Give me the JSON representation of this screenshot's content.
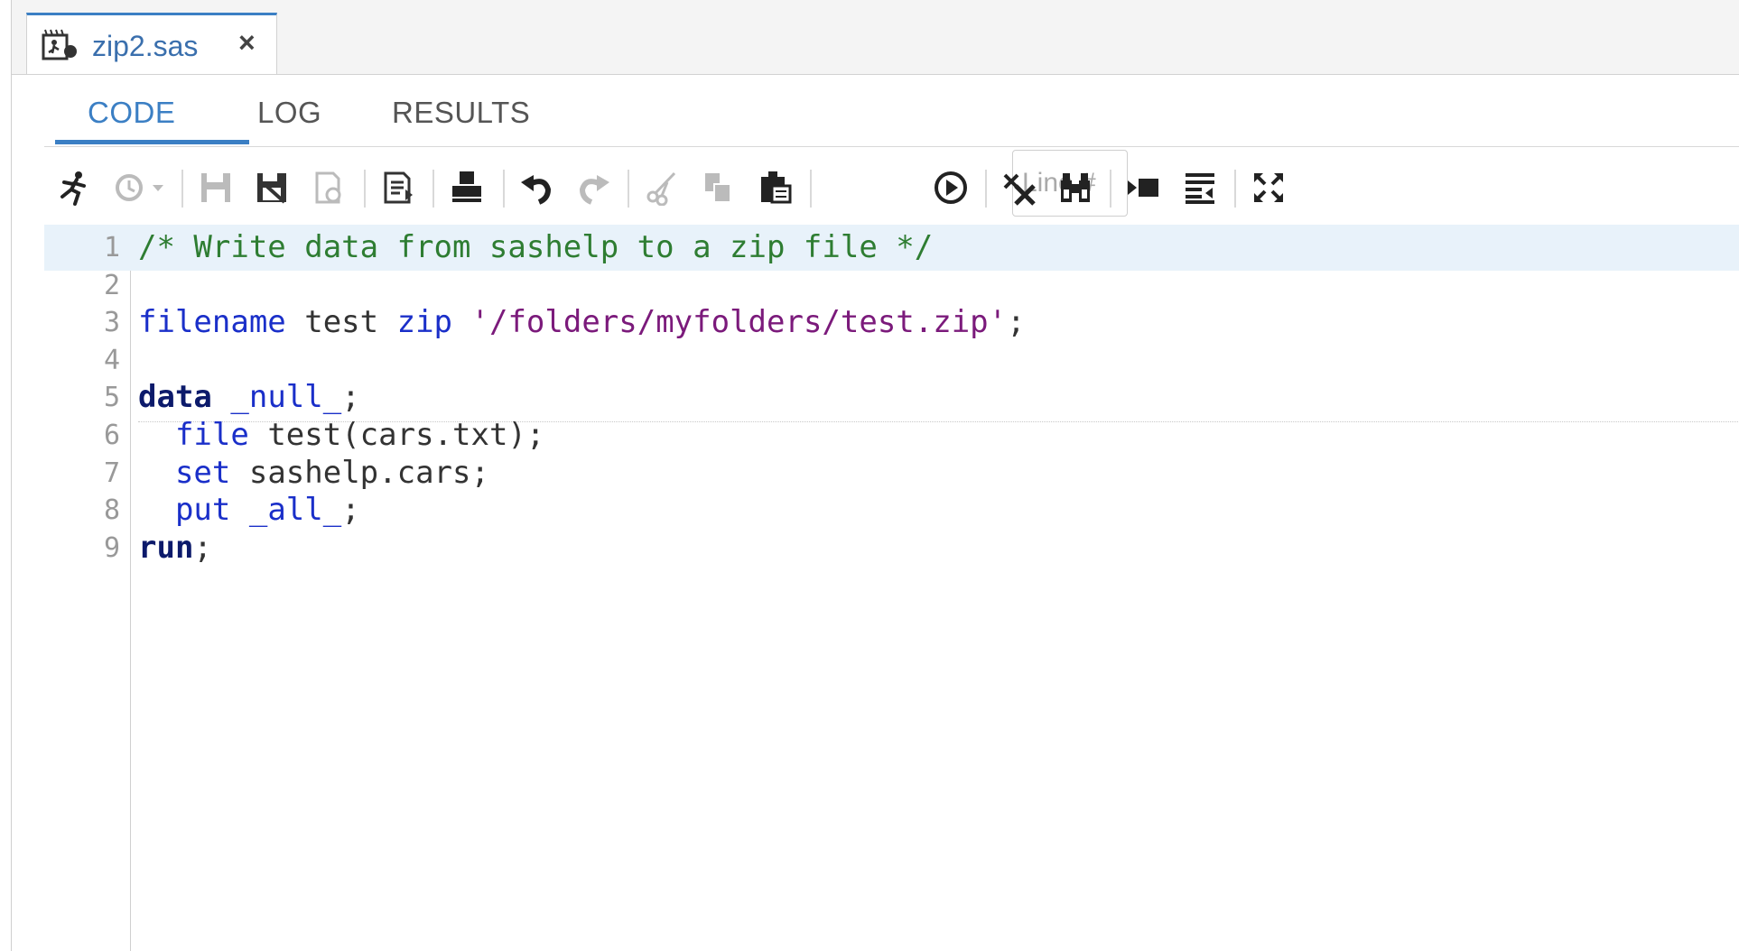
{
  "document_tab": {
    "icon": "sas-program-file-icon",
    "name": "zip2.sas",
    "close_glyph": "×"
  },
  "view_tabs": [
    {
      "label": "CODE",
      "active": true
    },
    {
      "label": "LOG",
      "active": false
    },
    {
      "label": "RESULTS",
      "active": false
    }
  ],
  "toolbar": {
    "line_input_placeholder": "Line #",
    "icons": [
      "run-icon",
      "history-icon",
      "save-icon",
      "save-as-icon",
      "open-icon",
      "export-code-icon",
      "print-icon",
      "undo-icon",
      "redo-icon",
      "cut-icon",
      "copy-icon",
      "paste-icon",
      "go-to-line-icon",
      "clear-icon",
      "find-replace-icon",
      "format-code-icon",
      "snippets-icon",
      "maximize-icon"
    ]
  },
  "colors": {
    "accent": "#3b7fc4",
    "comment": "#2e7d32",
    "keyword": "#1a2fc9",
    "string": "#7b1a7b",
    "step": "#0c1a6b"
  },
  "editor": {
    "current_line": 1,
    "lines": [
      {
        "num": "1",
        "tokens": [
          {
            "t": "/* Write data from sashelp to a zip file */",
            "c": "comment"
          }
        ]
      },
      {
        "num": "2",
        "tokens": []
      },
      {
        "num": "3",
        "tokens": [
          {
            "t": "filename",
            "c": "kw"
          },
          {
            "t": " test ",
            "c": "plain"
          },
          {
            "t": "zip",
            "c": "kw"
          },
          {
            "t": " ",
            "c": "plain"
          },
          {
            "t": "'/folders/myfolders/test.zip'",
            "c": "str"
          },
          {
            "t": ";",
            "c": "plain"
          }
        ]
      },
      {
        "num": "4",
        "tokens": []
      },
      {
        "num": "5",
        "tokens": [
          {
            "t": "data",
            "c": "step"
          },
          {
            "t": " ",
            "c": "plain"
          },
          {
            "t": "_null_",
            "c": "kw"
          },
          {
            "t": ";",
            "c": "plain"
          }
        ]
      },
      {
        "num": "6",
        "tokens": [
          {
            "t": "  ",
            "c": "plain"
          },
          {
            "t": "file",
            "c": "kw"
          },
          {
            "t": " test(cars.txt);",
            "c": "plain"
          }
        ]
      },
      {
        "num": "7",
        "tokens": [
          {
            "t": "  ",
            "c": "plain"
          },
          {
            "t": "set",
            "c": "kw"
          },
          {
            "t": " sashelp.cars;",
            "c": "plain"
          }
        ]
      },
      {
        "num": "8",
        "tokens": [
          {
            "t": "  ",
            "c": "plain"
          },
          {
            "t": "put",
            "c": "kw"
          },
          {
            "t": " ",
            "c": "plain"
          },
          {
            "t": "_all_",
            "c": "kw"
          },
          {
            "t": ";",
            "c": "plain"
          }
        ]
      },
      {
        "num": "9",
        "tokens": [
          {
            "t": "run",
            "c": "step"
          },
          {
            "t": ";",
            "c": "plain"
          }
        ]
      }
    ]
  }
}
